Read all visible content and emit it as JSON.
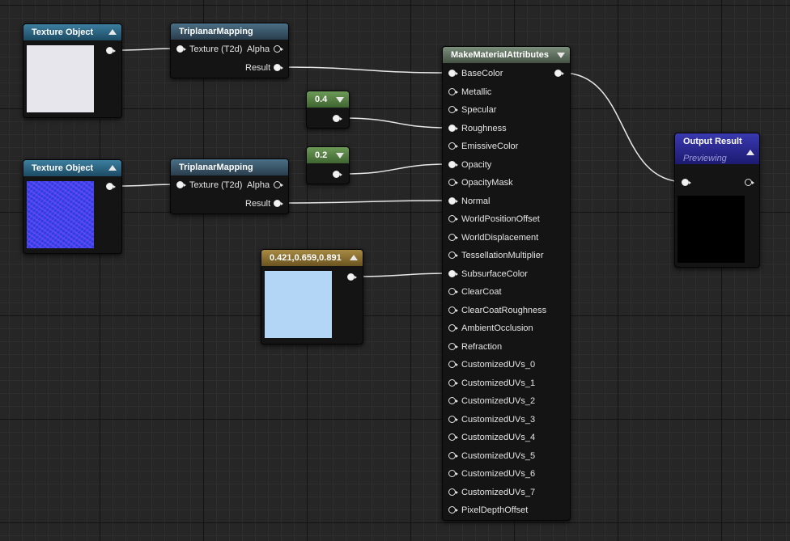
{
  "nodes": {
    "tex1": {
      "title": "Texture Object",
      "swatch_color": "#e6e6ec"
    },
    "tex2": {
      "title": "Texture Object",
      "swatch_color": "#3a3ae6"
    },
    "tri1": {
      "title": "TriplanarMapping",
      "input_label": "Texture (T2d)",
      "alpha_label": "Alpha",
      "result_label": "Result"
    },
    "tri2": {
      "title": "TriplanarMapping",
      "input_label": "Texture (T2d)",
      "alpha_label": "Alpha",
      "result_label": "Result"
    },
    "const1": {
      "value": "0.4"
    },
    "const2": {
      "value": "0.2"
    },
    "color": {
      "title": "0.421,0.659,0.891",
      "swatch_color": "#b4d6f6"
    },
    "make": {
      "title": "MakeMaterialAttributes",
      "inputs": [
        "BaseColor",
        "Metallic",
        "Specular",
        "Roughness",
        "EmissiveColor",
        "Opacity",
        "OpacityMask",
        "Normal",
        "WorldPositionOffset",
        "WorldDisplacement",
        "TessellationMultiplier",
        "SubsurfaceColor",
        "ClearCoat",
        "ClearCoatRoughness",
        "AmbientOcclusion",
        "Refraction",
        "CustomizedUVs_0",
        "CustomizedUVs_1",
        "CustomizedUVs_2",
        "CustomizedUVs_3",
        "CustomizedUVs_4",
        "CustomizedUVs_5",
        "CustomizedUVs_6",
        "CustomizedUVs_7",
        "PixelDepthOffset"
      ],
      "connected": [
        "BaseColor",
        "Roughness",
        "Opacity",
        "Normal",
        "SubsurfaceColor"
      ]
    },
    "output": {
      "title": "Output Result",
      "subtitle": "Previewing",
      "preview_color": "#000000"
    }
  },
  "colors": {
    "wire": "#e8e8e8",
    "grid_major": "#131313",
    "grid_minor": "#2e2e2e",
    "background": "#262626"
  }
}
